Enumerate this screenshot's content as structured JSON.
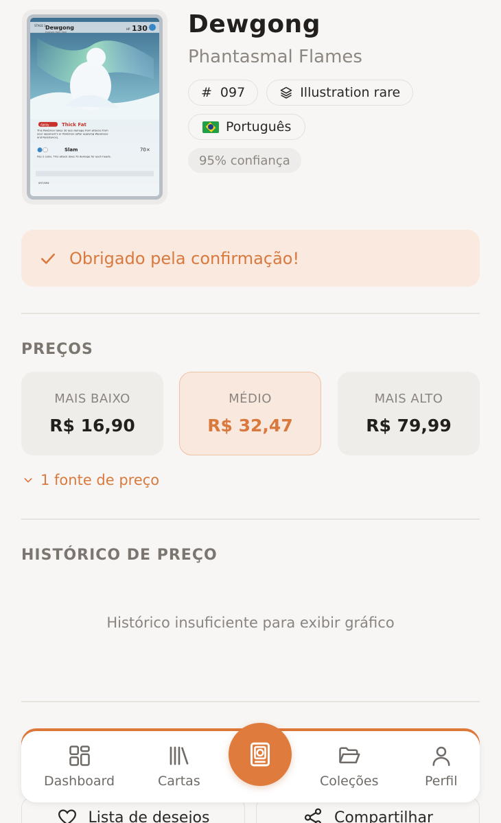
{
  "card": {
    "name": "Dewgong",
    "set": "Phantasmal Flames",
    "number_symbol": "#",
    "number": "097",
    "rarity": "Illustration rare",
    "language": "Português",
    "confidence": "95% confiança",
    "image": {
      "stage": "STAGE 1",
      "name": "Dewgong",
      "evolves": "Evolves from Seel",
      "hp_label": "HP",
      "hp": "130",
      "ability_tag": "Ability",
      "ability_name": "Thick Fat",
      "ability_text_1": "This Pokémon takes 30 less damage from attacks from",
      "ability_text_2": "your opponent's  or  Pokémon (after applying Weakness",
      "ability_text_3": "and Resistance).",
      "attack_name": "Slam",
      "attack_damage": "70×",
      "attack_text": "Flip 2 coins. This attack does 70 damage for each heads.",
      "card_number": "097/094"
    }
  },
  "banner": {
    "message": "Obrigado pela confirmação!"
  },
  "prices": {
    "title": "PREÇOS",
    "low_label": "MAIS BAIXO",
    "low_value": "R$ 16,90",
    "mid_label": "MÉDIO",
    "mid_value": "R$ 32,47",
    "high_label": "MAIS ALTO",
    "high_value": "R$ 79,99",
    "sources_label": "1 fonte de preço"
  },
  "history": {
    "title": "HISTÓRICO DE PREÇO",
    "empty_message": "Histórico insuficiente para exibir gráfico"
  },
  "actions": {
    "wishlist_label": "Lista de desejos",
    "share_label": "Compartilhar"
  },
  "nav": {
    "dashboard": "Dashboard",
    "cards": "Cartas",
    "collections": "Coleções",
    "profile": "Perfil"
  },
  "colors": {
    "accent": "#df7b3c",
    "accent_soft": "#f9e9df",
    "background": "#f8f6f4"
  }
}
